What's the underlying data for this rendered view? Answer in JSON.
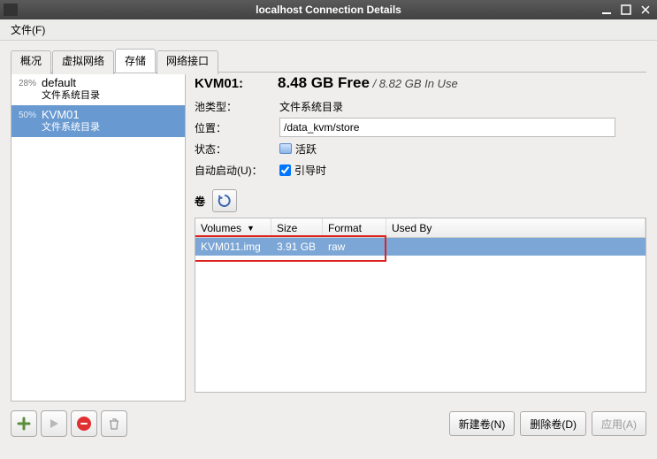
{
  "window": {
    "title": "localhost Connection Details"
  },
  "menu": {
    "file": "文件(F)"
  },
  "tabs": {
    "overview": "概况",
    "vnet": "虚拟网络",
    "storage": "存储",
    "nic": "网络接口"
  },
  "pools": [
    {
      "pct": "28%",
      "name": "default",
      "sub": "文件系统目录"
    },
    {
      "pct": "50%",
      "name": "KVM01",
      "sub": "文件系统目录"
    }
  ],
  "details": {
    "name": "KVM01:",
    "free": "8.48 GB Free",
    "inuse_sep": " / ",
    "inuse": "8.82 GB In Use",
    "labels": {
      "type": "池类型：",
      "loc": "位置：",
      "state": "状态：",
      "autostart": "自动启动(U)："
    },
    "type_val": "文件系统目录",
    "location": "/data_kvm/store",
    "state": "活跃",
    "autostart_val": "引导时",
    "vol_label": "卷"
  },
  "table": {
    "headers": {
      "volumes": "Volumes",
      "size": "Size",
      "format": "Format",
      "usedby": "Used By"
    },
    "rows": [
      {
        "name": "KVM011.img",
        "size": "3.91 GB",
        "format": "raw",
        "usedby": ""
      }
    ]
  },
  "buttons": {
    "newvol": "新建卷(N)",
    "delvol": "删除卷(D)",
    "apply": "应用(A)"
  }
}
